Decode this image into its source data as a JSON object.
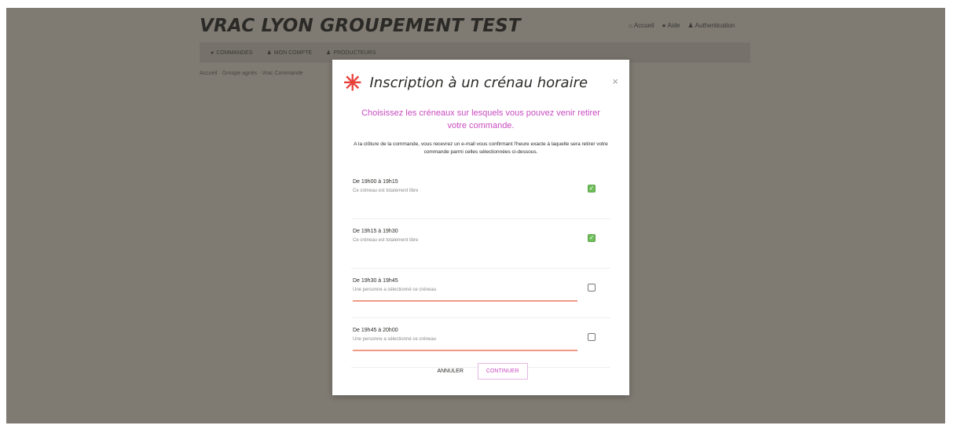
{
  "site": {
    "title": "VRAC LYON GROUPEMENT TEST"
  },
  "top_links": [
    {
      "label": "Accueil",
      "icon": "home-icon"
    },
    {
      "label": "Aide",
      "icon": "help-icon"
    },
    {
      "label": "Authentication",
      "icon": "user-icon"
    }
  ],
  "nav": [
    {
      "label": "COMMANDES",
      "icon": "cart-icon"
    },
    {
      "label": "MON COMPTE",
      "icon": "user-icon"
    },
    {
      "label": "PRODUCTEURS",
      "icon": "user-icon"
    }
  ],
  "breadcrumb": "Accueil · Groupe agnès · Vrac Commande",
  "modal": {
    "title": "Inscription à un crénau horaire",
    "close": "×",
    "subtitle": "Choisissez les créneaux sur lesquels vous pouvez venir retirer votre commande.",
    "intro": "A la clôture de la commande, vous recevrez un e-mail vous confirmant l'heure exacte à laquelle sera retirer votre commande parmi celles sélectionnées ci-dessous.",
    "slots": [
      {
        "time": "De 19h00 à 19h15",
        "info": "Ce créneau est totalement libre",
        "checked": true,
        "progress": 0
      },
      {
        "time": "De 19h15 à 19h30",
        "info": "Ce créneau est totalement libre",
        "checked": true,
        "progress": 0
      },
      {
        "time": "De 19h30 à 19h45",
        "info": "Une personne a sélectionné ce créneau",
        "checked": false,
        "progress": 1
      },
      {
        "time": "De 19h45 à 20h00",
        "info": "Une personne a sélectionné ce créneau",
        "checked": false,
        "progress": 1
      }
    ],
    "cancel_label": "ANNULER",
    "continue_label": "CONTINUER"
  },
  "colors": {
    "accent": "#c84bc0",
    "asterisk": "#e8413c",
    "check": "#6fbf5a",
    "progress": "#f29a86",
    "overlay": "#7f7b73"
  }
}
